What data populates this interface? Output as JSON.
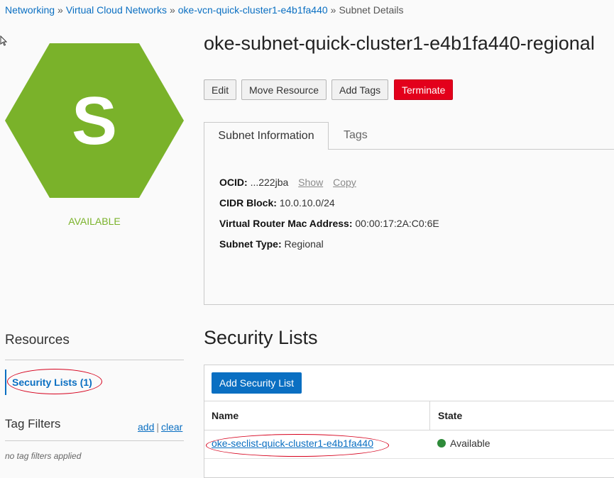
{
  "breadcrumb": {
    "items": [
      "Networking",
      "Virtual Cloud Networks",
      "oke-vcn-quick-cluster1-e4b1fa440"
    ],
    "separator": "»",
    "current": "Subnet Details"
  },
  "resource": {
    "icon_letter": "S",
    "icon_color": "#7ab22a",
    "state": "AVAILABLE",
    "title": "oke-subnet-quick-cluster1-e4b1fa440-regional"
  },
  "actions": {
    "edit": "Edit",
    "move": "Move Resource",
    "tags": "Add Tags",
    "terminate": "Terminate"
  },
  "tabs": {
    "info": "Subnet Information",
    "tags": "Tags"
  },
  "info": {
    "ocid_label": "OCID:",
    "ocid_value": "...222jba",
    "show": "Show",
    "copy": "Copy",
    "cidr_label": "CIDR Block:",
    "cidr_value": "10.0.10.0/24",
    "mac_label": "Virtual Router Mac Address:",
    "mac_value": "00:00:17:2A:C0:6E",
    "type_label": "Subnet Type:",
    "type_value": "Regional"
  },
  "sidebar": {
    "resources_heading": "Resources",
    "security_lists": "Security Lists (1)",
    "tag_filters_heading": "Tag Filters",
    "add": "add",
    "separator": "|",
    "clear": "clear",
    "no_filters": "no tag filters applied"
  },
  "security_lists": {
    "heading": "Security Lists",
    "add_button": "Add Security List",
    "columns": [
      "Name",
      "State"
    ],
    "rows": [
      {
        "name": "oke-seclist-quick-cluster1-e4b1fa440",
        "state": "Available"
      }
    ]
  },
  "colors": {
    "brand_blue": "#0a6fc2",
    "danger": "#e3001b",
    "status_green": "#2e8b3a",
    "annotation_red": "#d6001c"
  }
}
